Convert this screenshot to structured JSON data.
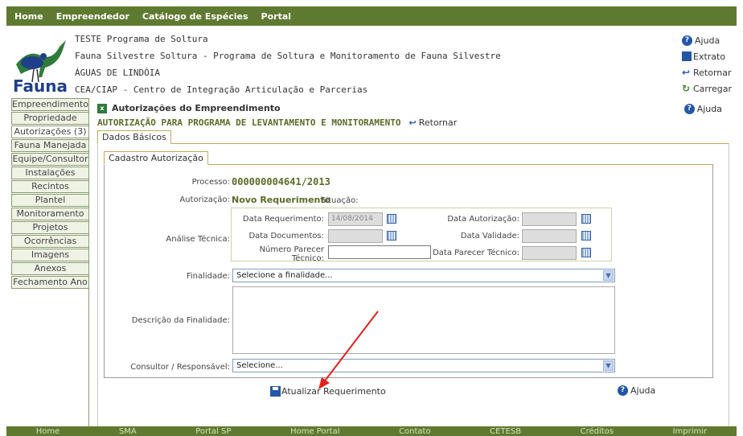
{
  "topnav": [
    "Home",
    "Empreendedor",
    "Catálogo de Espécies",
    "Portal"
  ],
  "header": {
    "logo_text": "Fauna",
    "lines": [
      "TESTE Programa de Soltura",
      "Fauna Silvestre Soltura - Programa de Soltura e Monitoramento de Fauna Silvestre",
      "ÁGUAS DE LINDÓIA",
      "CEA/CIAP - Centro de Integração Articulação e Parcerias"
    ],
    "links": {
      "ajuda": "Ajuda",
      "extrato": "Extrato",
      "retornar": "Retornar",
      "carregar": "Carregar"
    }
  },
  "sidebar": [
    "Empreendimento",
    "Propriedade",
    "Autorizações (3)",
    "Fauna Manejada",
    "Equipe/Consultor",
    "Instalações",
    "Recintos",
    "Plantel",
    "Monitoramento",
    "Projetos",
    "Ocorrências",
    "Imagens",
    "Anexos",
    "Fechamento Ano"
  ],
  "main": {
    "title": "Autorizações do Empreendimento",
    "subtitle": "AUTORIZAÇÃO PARA PROGRAMA DE LEVANTAMENTO E MONITORAMENTO",
    "retornar": "Retornar",
    "ajuda": "Ajuda",
    "tab_outer": "Dados Básicos",
    "tab_inner": "Cadastro Autorização"
  },
  "form": {
    "processo_label": "Processo:",
    "processo_value": "000000004641/2013",
    "autorizacao_label": "Autorização:",
    "autorizacao_value": "Novo Requerimento",
    "situacao_label": "Situação:",
    "analise_label": "Análise Técnica:",
    "data_requerimento_label": "Data Requerimento:",
    "data_requerimento_value": "14/08/2014",
    "data_autorizacao_label": "Data Autorização:",
    "data_documentos_label": "Data Documentos:",
    "data_validade_label": "Data Validade:",
    "numero_parecer_label_1": "Número Parecer",
    "numero_parecer_label_2": "Técnico:",
    "data_parecer_label": "Data Parecer Técnico:",
    "finalidade_label": "Finalidade:",
    "finalidade_value": "Selecione a finalidade...",
    "descricao_label": "Descrição da Finalidade:",
    "consultor_label": "Consultor / Responsável:",
    "consultor_value": "Selecione...",
    "atualizar_button": "Atualizar Requerimento",
    "ajuda": "Ajuda"
  },
  "footer": [
    "Home",
    "SMA",
    "Portal SP",
    "Home Portal",
    "Contato",
    "CETESB",
    "Créditos",
    "Imprimir"
  ],
  "colors": {
    "brand_green": "#5f7a30",
    "title_green": "#5a6b27",
    "tab_border": "#c7a85a",
    "help_blue": "#2457a8"
  }
}
